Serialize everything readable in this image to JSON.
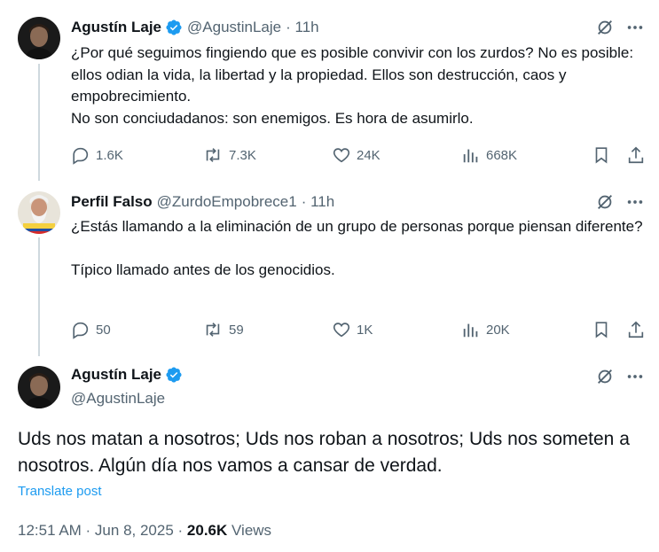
{
  "tweets": [
    {
      "name": "Agustín Laje",
      "handle": "@AgustinLaje",
      "time": "· 11h",
      "text": "¿Por qué seguimos fingiendo que es posible convivir con los zurdos? No es posible: ellos odian la vida, la libertad y la propiedad. Ellos son destrucción, caos y empobrecimiento.\nNo son conciudadanos: son enemigos. Es hora de asumirlo.",
      "replies": "1.6K",
      "reposts": "7.3K",
      "likes": "24K",
      "views": "668K"
    },
    {
      "name": "Perfil Falso",
      "handle": "@ZurdoEmpobrece1",
      "time": "· 11h",
      "text": "¿Estás llamando a la eliminación de un grupo de personas porque piensan diferente?\n\nTípico llamado antes de los genocidios.",
      "replies": "50",
      "reposts": "59",
      "likes": "1K",
      "views": "20K"
    }
  ],
  "main": {
    "name": "Agustín Laje",
    "handle": "@AgustinLaje",
    "text": "Uds nos matan a nosotros; Uds nos roban a nosotros; Uds nos someten a nosotros. Algún día nos vamos a cansar de verdad.",
    "translate": "Translate post",
    "timestamp": "12:51 AM · Jun 8, 2025 · ",
    "views_count": "20.6K",
    "views_label": " Views"
  },
  "colors": {
    "accent": "#1d9bf0",
    "secondary_text": "#536471",
    "primary_text": "#0f1419",
    "thread_line": "#cfd9de"
  },
  "icons": [
    "grok-icon",
    "more-icon",
    "verified-badge-icon",
    "reply-icon",
    "repost-icon",
    "like-icon",
    "views-icon",
    "bookmark-icon",
    "share-icon"
  ]
}
